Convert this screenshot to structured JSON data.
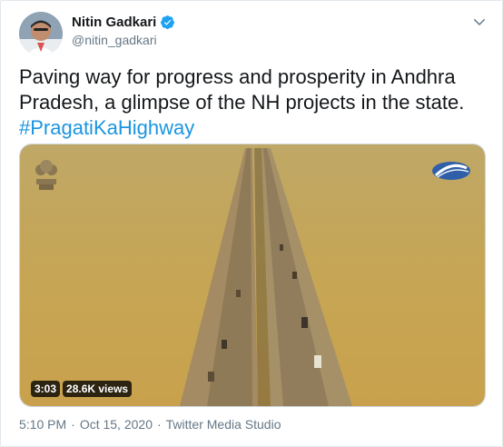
{
  "author": {
    "display_name": "Nitin Gadkari",
    "handle": "@nitin_gadkari",
    "verified": true
  },
  "tweet": {
    "text": "Paving way for progress and prosperity in Andhra Pradesh, a glimpse of the NH projects in the state.",
    "hashtag": "#PragatiKaHighway"
  },
  "media": {
    "duration": "3:03",
    "views": "28.6K views"
  },
  "meta": {
    "time": "5:10 PM",
    "separator": "·",
    "date": "Oct 15, 2020",
    "source": "Twitter Media Studio"
  },
  "colors": {
    "link": "#1b95e0",
    "verified": "#1da1f2",
    "water": "#c9a95a",
    "muted": "#657786"
  },
  "icons": {
    "verified": "verified-badge-icon",
    "menu": "chevron-down-icon"
  }
}
